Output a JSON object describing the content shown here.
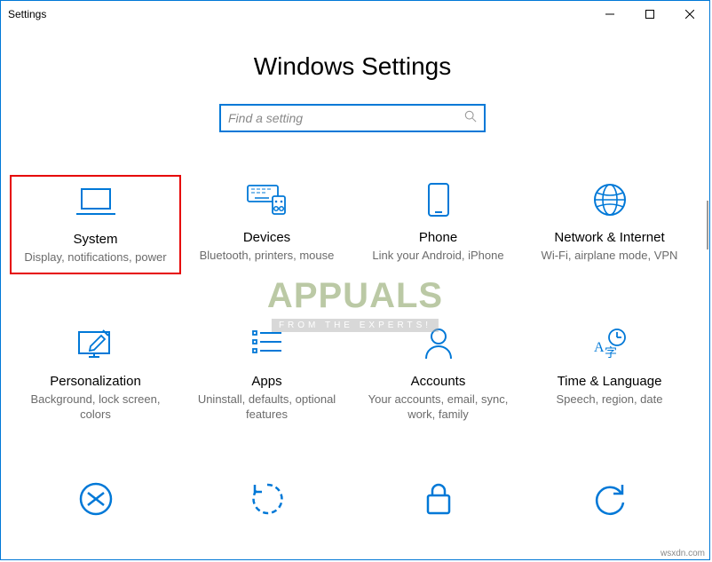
{
  "window": {
    "title": "Settings"
  },
  "header": {
    "title": "Windows Settings"
  },
  "search": {
    "placeholder": "Find a setting"
  },
  "tiles": [
    {
      "id": "system",
      "title": "System",
      "desc": "Display, notifications, power",
      "highlight": true
    },
    {
      "id": "devices",
      "title": "Devices",
      "desc": "Bluetooth, printers, mouse",
      "highlight": false
    },
    {
      "id": "phone",
      "title": "Phone",
      "desc": "Link your Android, iPhone",
      "highlight": false
    },
    {
      "id": "network",
      "title": "Network & Internet",
      "desc": "Wi-Fi, airplane mode, VPN",
      "highlight": false
    },
    {
      "id": "personalization",
      "title": "Personalization",
      "desc": "Background, lock screen, colors",
      "highlight": false
    },
    {
      "id": "apps",
      "title": "Apps",
      "desc": "Uninstall, defaults, optional features",
      "highlight": false
    },
    {
      "id": "accounts",
      "title": "Accounts",
      "desc": "Your accounts, email, sync, work, family",
      "highlight": false
    },
    {
      "id": "time",
      "title": "Time & Language",
      "desc": "Speech, region, date",
      "highlight": false
    }
  ],
  "watermark": {
    "main": "APPUALS",
    "sub": "FROM THE EXPERTS!"
  },
  "footer": {
    "text": "wsxdn.com"
  }
}
